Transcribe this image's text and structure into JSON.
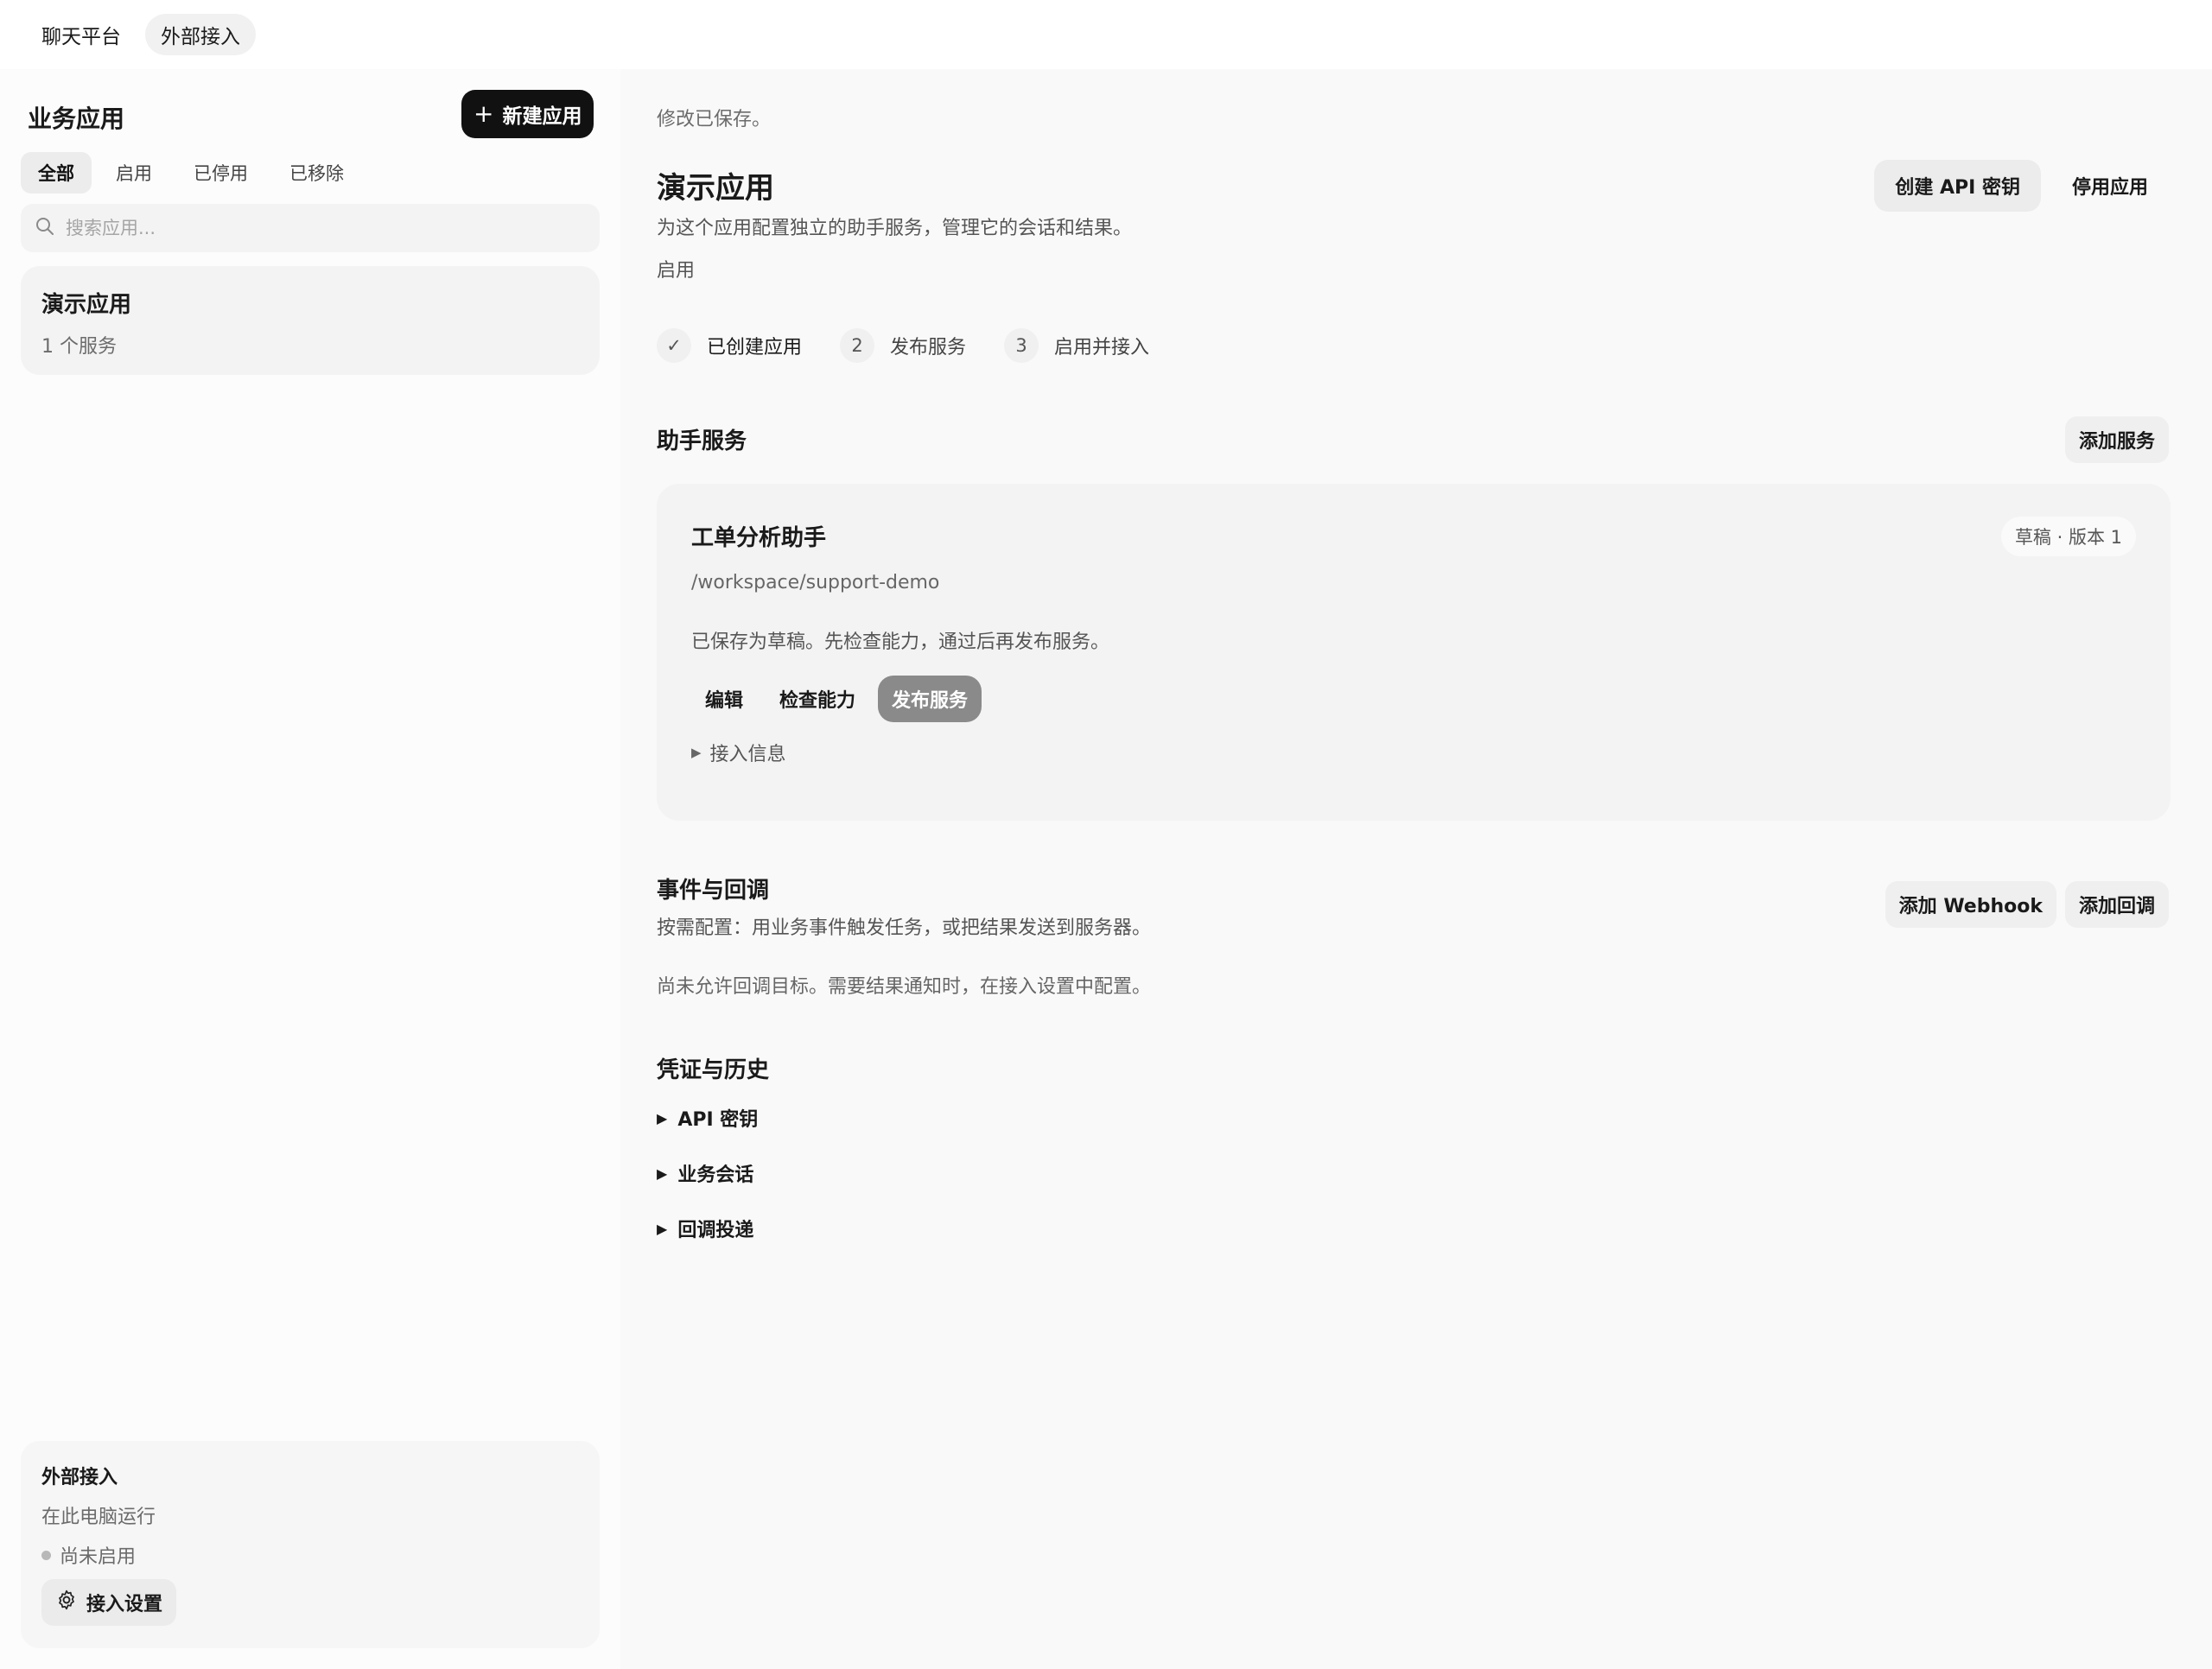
{
  "topnav": {
    "items": [
      {
        "label": "聊天平台",
        "active": false
      },
      {
        "label": "外部接入",
        "active": true
      }
    ]
  },
  "sidebar": {
    "title": "业务应用",
    "new_app_label": "新建应用",
    "filters": [
      "全部",
      "启用",
      "已停用",
      "已移除"
    ],
    "active_filter": "全部",
    "search_placeholder": "搜索应用...",
    "apps": [
      {
        "name": "演示应用",
        "sub": "1 个服务"
      }
    ],
    "external": {
      "title": "外部接入",
      "runtime": "在此电脑运行",
      "status": "尚未启用",
      "settings_label": "接入设置"
    }
  },
  "main": {
    "saved_note": "修改已保存。",
    "app": {
      "title": "演示应用",
      "description": "为这个应用配置独立的助手服务，管理它的会话和结果。",
      "state": "启用",
      "create_key_label": "创建 API 密钥",
      "disable_label": "停用应用"
    },
    "steps": [
      {
        "marker": "✓",
        "label": "已创建应用",
        "done": true
      },
      {
        "marker": "2",
        "label": "发布服务",
        "done": false
      },
      {
        "marker": "3",
        "label": "启用并接入",
        "done": false
      }
    ],
    "services": {
      "title": "助手服务",
      "add_label": "添加服务",
      "card": {
        "name": "工单分析助手",
        "badge": "草稿 · 版本 1",
        "path": "/workspace/support-demo",
        "note": "已保存为草稿。先检查能力，通过后再发布服务。",
        "edit_label": "编辑",
        "check_label": "检查能力",
        "publish_label": "发布服务",
        "access_info_label": "接入信息"
      }
    },
    "events": {
      "title": "事件与回调",
      "description": "按需配置：用业务事件触发任务，或把结果发送到服务器。",
      "empty": "尚未允许回调目标。需要结果通知时，在接入设置中配置。",
      "add_webhook_label": "添加 Webhook",
      "add_callback_label": "添加回调"
    },
    "credentials": {
      "title": "凭证与历史",
      "items": [
        "API 密钥",
        "业务会话",
        "回调投递"
      ]
    }
  }
}
